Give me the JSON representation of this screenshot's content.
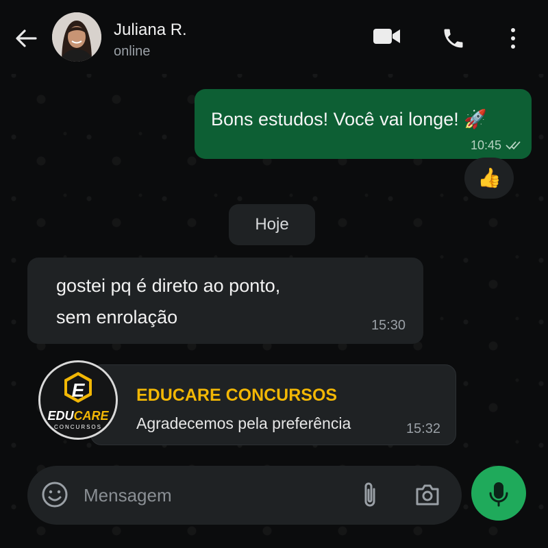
{
  "header": {
    "contact_name": "Juliana R.",
    "status": "online"
  },
  "messages": {
    "outgoing": {
      "text": "Bons estudos! Você vai longe! 🚀",
      "time": "10:45",
      "reaction": "👍"
    },
    "date_chip": "Hoje",
    "incoming_1": {
      "line1": "gostei pq é direto ao ponto,",
      "line2": "sem enrolação",
      "time": "15:30"
    },
    "incoming_2": {
      "sender": "EDUCARE CONCURSOS",
      "text": "Agradecemos pela preferência",
      "time": "15:32"
    }
  },
  "brand_logo": {
    "letter": "E",
    "name_part1": "EDU",
    "name_part2": "CARE",
    "tagline": "CONCURSOS"
  },
  "composer": {
    "placeholder": "Mensagem"
  },
  "colors": {
    "outgoing_bubble": "#0d5f34",
    "incoming_bubble": "#1f2224",
    "accent_green": "#1faa5b",
    "brand_yellow": "#f2b705"
  },
  "icons": [
    "back-arrow-icon",
    "video-call-icon",
    "phone-icon",
    "more-vert-icon",
    "double-check-icon",
    "emoji-icon",
    "attach-icon",
    "camera-icon",
    "mic-icon"
  ]
}
